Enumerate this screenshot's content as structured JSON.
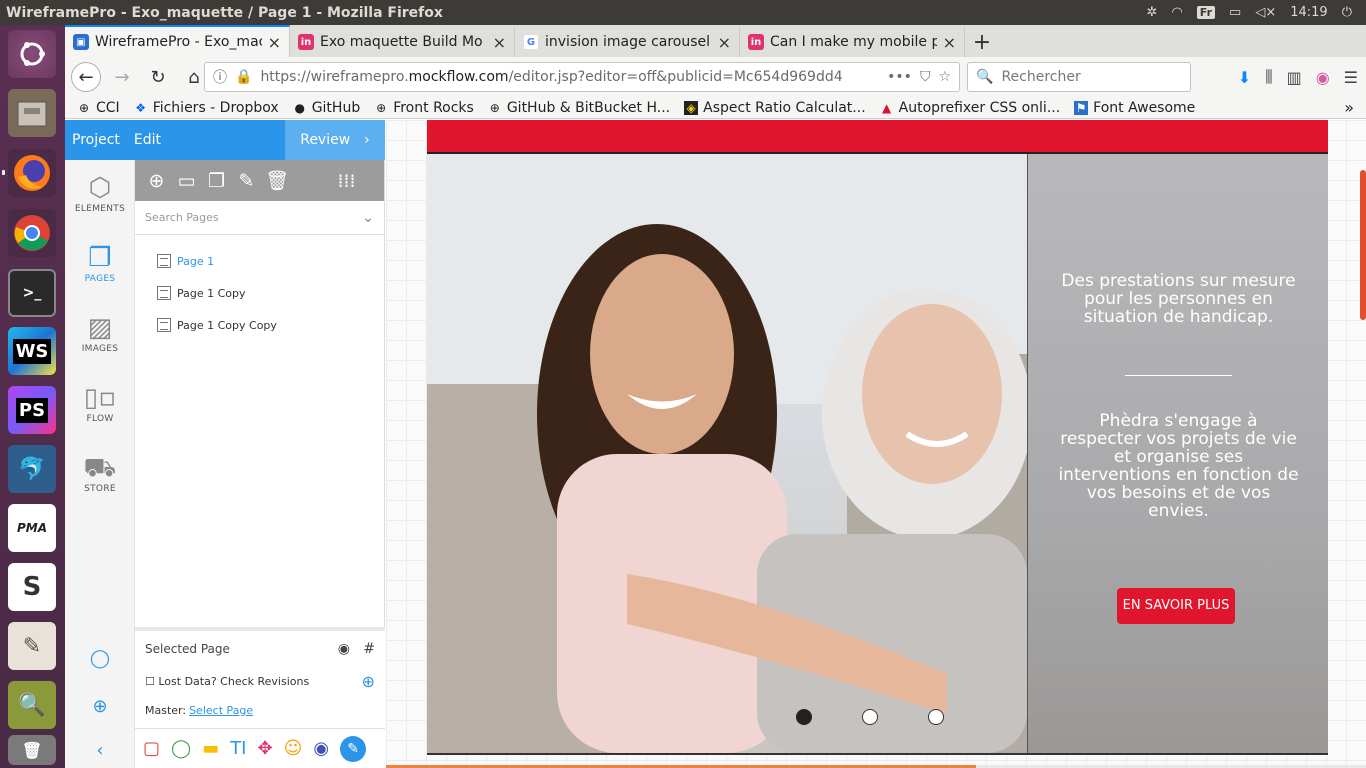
{
  "os": {
    "window_title": "WireframePro - Exo_maquette / Page 1 - Mozilla Firefox",
    "keyboard_layout": "Fr",
    "clock": "14:19",
    "launcher_apps": [
      "ubuntu-dash",
      "file-manager",
      "firefox",
      "chrome",
      "terminal",
      "webstorm",
      "phpstorm",
      "mysql-workbench",
      "phpmyadmin",
      "slack",
      "text-editor",
      "screenshot-tool",
      "trash"
    ]
  },
  "browser": {
    "tabs": [
      {
        "label": "WireframePro - Exo_mac",
        "close": "×",
        "favicon": "wireframepro"
      },
      {
        "label": "Exo maquette Build Mo",
        "close": "×",
        "favicon": "invision"
      },
      {
        "label": "invision image carousel",
        "close": "×",
        "favicon": "google"
      },
      {
        "label": "Can I make my mobile pr",
        "close": "×",
        "favicon": "invision"
      }
    ],
    "new_tab": "+",
    "url_prefix": "https://wireframepro.",
    "url_host": "mockflow.com",
    "url_rest": "/editor.jsp?editor=off&publicid=Mc654d969dd4",
    "url_more": "•••",
    "search_placeholder": "Rechercher",
    "bookmarks": [
      {
        "label": "CCI",
        "icon": "globe-icon"
      },
      {
        "label": "Fichiers - Dropbox",
        "icon": "dropbox-icon"
      },
      {
        "label": "GitHub",
        "icon": "github-icon"
      },
      {
        "label": "Front Rocks",
        "icon": "globe-icon"
      },
      {
        "label": "GitHub & BitBucket H...",
        "icon": "globe-icon"
      },
      {
        "label": "Aspect Ratio Calculat...",
        "icon": "aspect-ratio-icon"
      },
      {
        "label": "Autoprefixer CSS onli...",
        "icon": "autoprefixer-icon"
      },
      {
        "label": "Font Awesome",
        "icon": "flag-icon"
      }
    ],
    "bookmarks_overflow": "»"
  },
  "editor": {
    "menu": {
      "project": "Project",
      "edit": "Edit",
      "review": "Review",
      "review_arrow": "›"
    },
    "rail": [
      {
        "label": "ELEMENTS",
        "icon": "cube-icon",
        "active": false
      },
      {
        "label": "PAGES",
        "icon": "pages-icon",
        "active": true
      },
      {
        "label": "IMAGES",
        "icon": "image-icon",
        "active": false
      },
      {
        "label": "FLOW",
        "icon": "flow-icon",
        "active": false
      },
      {
        "label": "STORE",
        "icon": "store-icon",
        "active": false
      }
    ],
    "pages_search_placeholder": "Search Pages",
    "pages": [
      {
        "label": "Page 1",
        "selected": true
      },
      {
        "label": "Page 1 Copy",
        "selected": false
      },
      {
        "label": "Page 1 Copy Copy",
        "selected": false
      }
    ],
    "footer": {
      "selected_page": "Selected Page",
      "lost_data": "Lost Data? Check Revisions",
      "master_label": "Master:",
      "master_link": "Select Page"
    }
  },
  "mockup": {
    "accent": "#e1152d",
    "heading": "Des prestations sur mesure pour les personnes en situation de handicap.",
    "paragraph": "Phèdra s'engage à respecter vos projets de vie et organise ses interventions en fonction de vos besoins et de vos envies.",
    "button": "EN SAVOIR PLUS",
    "carousel_active_index": 0,
    "carousel_count": 3
  }
}
